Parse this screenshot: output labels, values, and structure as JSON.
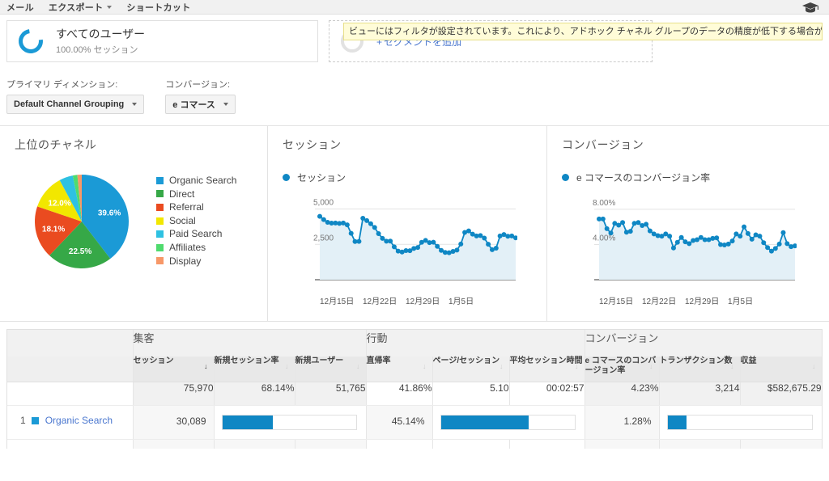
{
  "topbar": {
    "items": [
      {
        "label": "メール",
        "caret": false
      },
      {
        "label": "エクスポート",
        "caret": true
      },
      {
        "label": "ショートカット",
        "caret": false
      }
    ],
    "help_icon": "graduation-cap-icon"
  },
  "warning": {
    "text": "ビューにはフィルタが設定されています。これにより、アドホック チャネル グループのデータの精度が低下する場合があります。"
  },
  "segment": {
    "title": "すべてのユーザー",
    "subtitle": "100.00% セッション",
    "add_plus": "+",
    "add_label": "セグメントを追加"
  },
  "controls": {
    "primary_dimension_label": "プライマリ ディメンション:",
    "primary_dimension_value": "Default Channel Grouping",
    "conversion_label": "コンバージョン:",
    "conversion_value": "e コマース"
  },
  "panels": {
    "pie_title": "上位のチャネル",
    "sessions_title": "セッション",
    "conversions_title": "コンバージョン"
  },
  "chart_data": [
    {
      "type": "pie",
      "title": "上位のチャネル",
      "labels": [
        "Organic Search",
        "Direct",
        "Referral",
        "Social",
        "Paid Search",
        "Affiliates",
        "Display"
      ],
      "values": [
        39.6,
        22.5,
        18.1,
        12.0,
        4.7,
        1.6,
        1.5
      ],
      "value_labels": [
        "39.6%",
        "22.5%",
        "18.1%",
        "12.0%",
        "",
        "",
        ""
      ],
      "colors": [
        "#1b9ad6",
        "#36a847",
        "#ea4b20",
        "#f2e700",
        "#2ec1e2",
        "#4fdb6e",
        "#f79868"
      ],
      "legend_position": "right"
    },
    {
      "type": "area",
      "title": "セッション",
      "legend": [
        "セッション"
      ],
      "ylabel": "",
      "xlabel": "",
      "ylim": [
        0,
        5600
      ],
      "yticks": [
        2500,
        5000
      ],
      "ytick_labels": [
        "2,500",
        "5,000"
      ],
      "xtick_labels": [
        "12月15日",
        "12月22日",
        "12月29日",
        "1月5日"
      ],
      "grid": true,
      "series": [
        {
          "name": "セッション",
          "values": [
            4480,
            4250,
            4060,
            4000,
            4010,
            3980,
            4010,
            3880,
            3280,
            2700,
            2710,
            4340,
            4180,
            3960,
            3690,
            3260,
            2920,
            2720,
            2730,
            2320,
            2020,
            1960,
            2060,
            2050,
            2210,
            2280,
            2640,
            2780,
            2620,
            2650,
            2360,
            2070,
            1930,
            1910,
            2000,
            2090,
            2520,
            3340,
            3450,
            3220,
            3090,
            3120,
            2940,
            2510,
            2120,
            2230,
            3090,
            3190,
            3070,
            3090,
            2960
          ]
        }
      ]
    },
    {
      "type": "area",
      "title": "コンバージョン",
      "legend": [
        "e コマースのコンバージョン率"
      ],
      "ylabel": "",
      "xlabel": "",
      "ylim": [
        0,
        9.0
      ],
      "yticks": [
        4.0,
        8.0
      ],
      "ytick_labels": [
        "4.00%",
        "8.00%"
      ],
      "xtick_labels": [
        "12月15日",
        "12月22日",
        "12月29日",
        "1月5日"
      ],
      "grid": true,
      "series": [
        {
          "name": "e コマースのコンバージョン率",
          "values": [
            6.9,
            6.9,
            5.8,
            5.3,
            6.4,
            6.2,
            6.5,
            5.4,
            5.5,
            6.4,
            6.5,
            6.15,
            6.3,
            5.55,
            5.2,
            5.0,
            4.95,
            5.2,
            4.95,
            3.6,
            4.25,
            4.8,
            4.3,
            4.1,
            4.45,
            4.55,
            4.8,
            4.55,
            4.55,
            4.7,
            4.75,
            4.0,
            3.95,
            4.05,
            4.4,
            5.2,
            4.95,
            6.0,
            5.25,
            4.6,
            5.1,
            4.95,
            4.2,
            3.65,
            3.25,
            3.55,
            4.05,
            5.35,
            4.1,
            3.75,
            3.85
          ]
        }
      ]
    }
  ],
  "table": {
    "groups": [
      {
        "label": "",
        "span": 1
      },
      {
        "label": "集客",
        "span": 3
      },
      {
        "label": "行動",
        "span": 3
      },
      {
        "label": "コンバージョン",
        "span": 3
      }
    ],
    "columns": [
      {
        "label": "",
        "sortable": false,
        "sorted": false,
        "shaded": false
      },
      {
        "label": "セッション",
        "sortable": true,
        "sorted": true,
        "shaded": true
      },
      {
        "label": "新規セッション率",
        "sortable": true,
        "sorted": false,
        "shaded": true
      },
      {
        "label": "新規ユーザー",
        "sortable": true,
        "sorted": false,
        "shaded": true
      },
      {
        "label": "直帰率",
        "sortable": true,
        "sorted": false,
        "shaded": false
      },
      {
        "label": "ページ/セッション",
        "sortable": true,
        "sorted": false,
        "shaded": false
      },
      {
        "label": "平均セッション時間",
        "sortable": true,
        "sorted": false,
        "shaded": false
      },
      {
        "label": "e コマースのコンバージョン率",
        "sortable": true,
        "sorted": false,
        "shaded": true
      },
      {
        "label": "トランザクション数",
        "sortable": true,
        "sorted": false,
        "shaded": true
      },
      {
        "label": "収益",
        "sortable": true,
        "sorted": false,
        "shaded": true
      }
    ],
    "totals": [
      "",
      "75,970",
      "68.14%",
      "51,765",
      "41.86%",
      "5.10",
      "00:02:57",
      "4.23%",
      "3,214",
      "$582,675.29"
    ],
    "rows": [
      {
        "index": "1",
        "name": "Organic Search",
        "sessions": "30,089",
        "new_session_rate_bar": 38,
        "new_users_bar": 0,
        "bounce_rate": "45.14%",
        "pages_per_session_bar": 66,
        "avg_duration_bar": 0,
        "ecommerce_conversion_rate": "1.28%",
        "transactions_bar": 13,
        "revenue_bar": 0
      }
    ]
  },
  "colors": {
    "accent": "#0f87c4",
    "pie_organic": "#1b9ad6",
    "pie_direct": "#36a847",
    "pie_referral": "#ea4b20",
    "pie_social": "#f2e700",
    "pie_paid": "#2ec1e2",
    "pie_affiliates": "#4fdb6e",
    "pie_display": "#f79868",
    "warning_bg": "#fffcd8",
    "link": "#4a77cf"
  }
}
